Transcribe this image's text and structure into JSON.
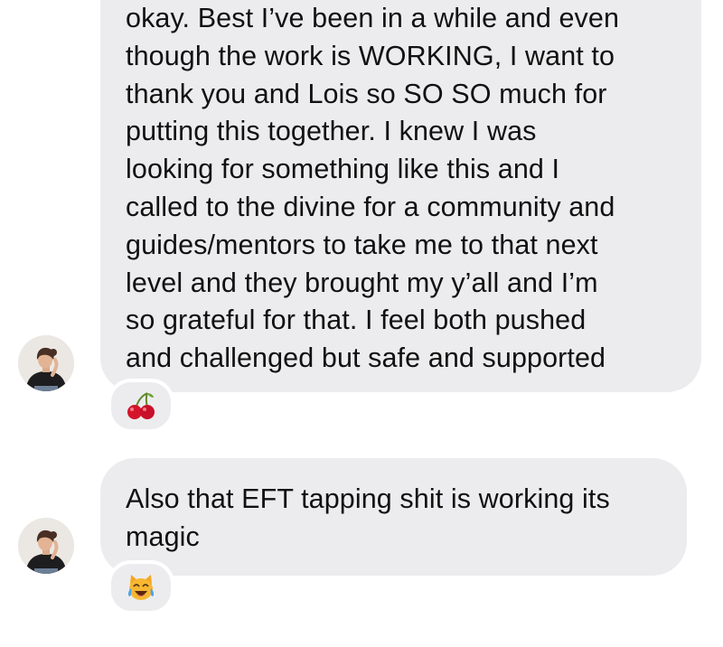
{
  "messages": [
    {
      "sender_avatar": "avatar-woman-black-top",
      "lines": [
        "okay. Best I’ve been in a while and even",
        "though the work is WORKING, I want to",
        "thank you and Lois so SO SO much for",
        "putting this together. I knew I was",
        "looking for something like this and I",
        "called to the divine for a community and",
        "guides/mentors to take me to that next",
        "level and they brought my y’all and I’m",
        "so grateful for that. I feel both pushed",
        "and challenged but safe and supported"
      ],
      "reaction": {
        "emoji": "🍒",
        "icon": "cherry-icon"
      }
    },
    {
      "sender_avatar": "avatar-woman-black-top",
      "lines": [
        "Also that EFT tapping shit is working its",
        "magic"
      ],
      "reaction": {
        "emoji": "😹",
        "icon": "cat-tears-of-joy-icon"
      }
    }
  ],
  "colors": {
    "bubble": "#ececee",
    "text": "#111111",
    "background": "#ffffff"
  }
}
